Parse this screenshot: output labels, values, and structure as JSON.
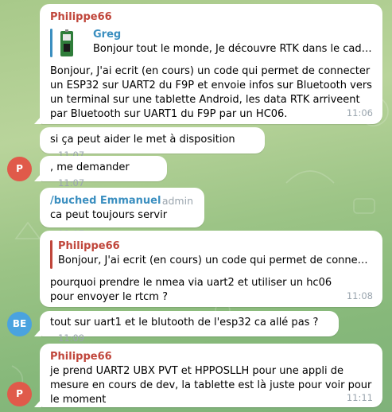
{
  "messages": [
    {
      "sender": "Philippe66",
      "reply_to": {
        "name": "Greg",
        "text": "Bonjour tout le monde, Je découvre RTK dans le cadre d'..."
      },
      "text": "Bonjour, J'ai ecrit (en cours) un code qui permet de connecter un ESP32 sur UART2 du F9P et envoie infos sur Bluetooth vers un terminal sur une tablette Android, les data RTK arriveent par Bluetooth sur UART1 du F9P par un HC06.",
      "time": "11:06"
    },
    {
      "text": "si ça peut aider le met à disposition",
      "time": "11:07"
    },
    {
      "text": ", me demander",
      "time": "11:07",
      "avatar": "P"
    },
    {
      "sender": "/buched Emmanuel",
      "role": "admin",
      "text": "ca peut toujours servir",
      "time": "11:07"
    },
    {
      "reply_to": {
        "name": "Philippe66",
        "text": "Bonjour, J'ai ecrit (en cours) un code qui permet de connecter u..."
      },
      "text": "pourquoi prendre le nmea via uart2 et utiliser un hc06 pour envoyer le rtcm ?",
      "time": "11:08"
    },
    {
      "text": "tout sur uart1 et le blutooth de l'esp32 ca allé pas ?",
      "time": "11:09",
      "avatar": "BE"
    },
    {
      "sender": "Philippe66",
      "text": "je prend UART2 UBX PVT et HPPOSLLH pour une appli de mesure en cours de dev, la tablette est là juste pour voir pour le moment",
      "time": "11:11",
      "avatar": "P"
    }
  ],
  "colors": {
    "sender_red": "#c0463b",
    "sender_blue": "#3b8fc0",
    "avatar_p": "#e05a4a",
    "avatar_be": "#4aa3df",
    "time_grey": "#9aa5ae"
  },
  "icons": [
    "device-thumbnail-icon"
  ]
}
